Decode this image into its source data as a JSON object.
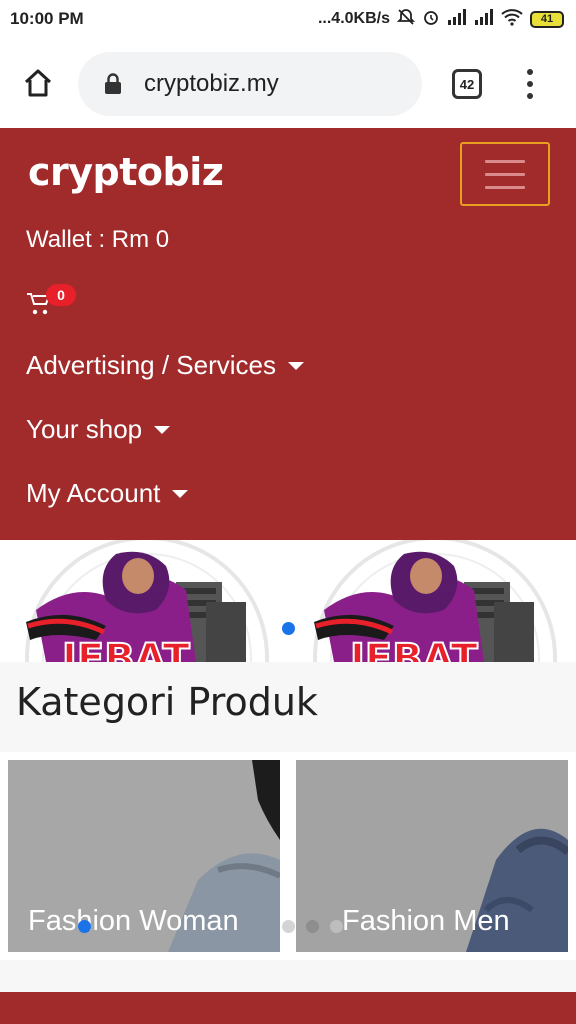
{
  "status_bar": {
    "time": "10:00 PM",
    "network_speed": "...4.0KB/s",
    "battery": "41"
  },
  "browser": {
    "url": "cryptobiz.my",
    "tab_count": "42"
  },
  "site": {
    "brand": "cryptobiz",
    "wallet": "Wallet : Rm 0",
    "cart_count": "0",
    "nav": [
      {
        "label": "Advertising / Services"
      },
      {
        "label": "Your shop"
      },
      {
        "label": "My Account"
      }
    ]
  },
  "banner": {
    "logo_text": "JEBAT"
  },
  "kategori": {
    "title": "Kategori Produk",
    "products": [
      {
        "label": "Fashion Woman"
      },
      {
        "label": "Fashion Men"
      }
    ]
  },
  "colors": {
    "brand_red": "#a12a2a",
    "accent_blue": "#1a73e8",
    "badge_red": "#e8202a",
    "toggler_border": "#e8a020"
  },
  "icons": [
    "home-icon",
    "lock-icon",
    "tabs-icon",
    "more-vert-icon",
    "cart-icon",
    "hamburger-icon",
    "alarm-icon",
    "wifi-icon",
    "signal-icon"
  ]
}
